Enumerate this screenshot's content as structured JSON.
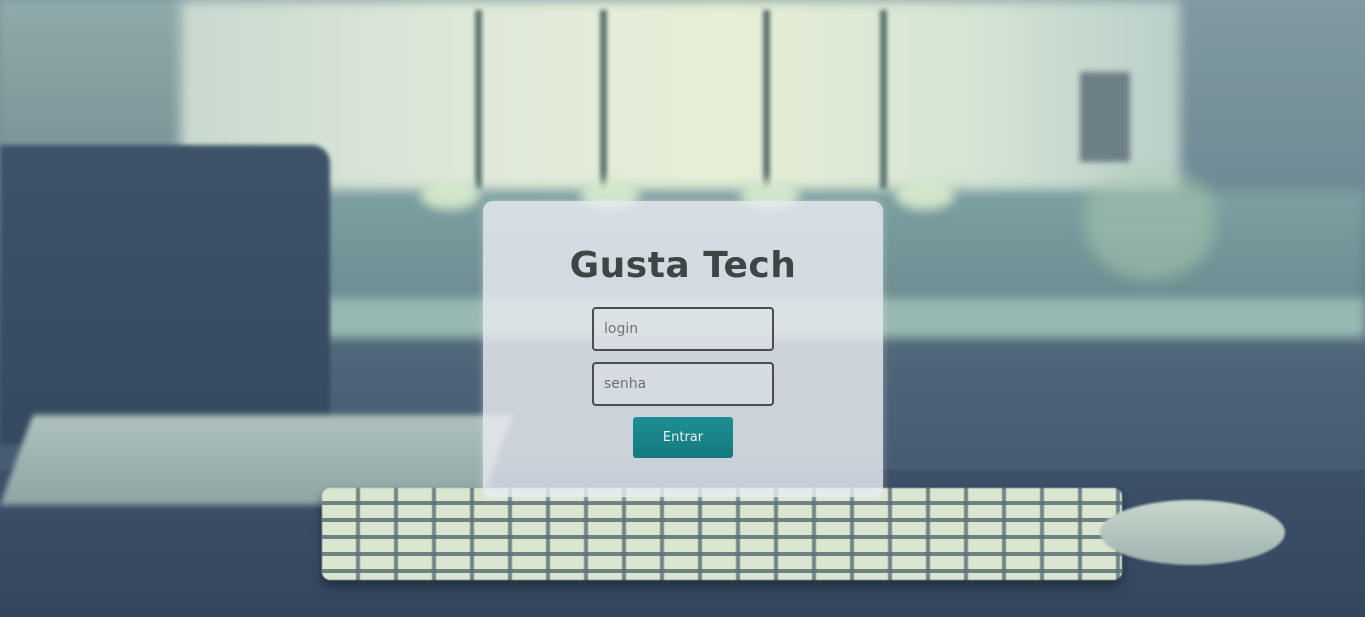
{
  "login_card": {
    "title": "Gusta Tech",
    "login_placeholder": "login",
    "login_value": "",
    "password_placeholder": "senha",
    "password_value": "",
    "submit_label": "Entrar"
  },
  "colors": {
    "button_bg": "#178489",
    "button_text": "#e6f3f3",
    "title_text": "#3c4646",
    "field_border": "#4a4e52",
    "card_bg": "#e8ecf0"
  }
}
